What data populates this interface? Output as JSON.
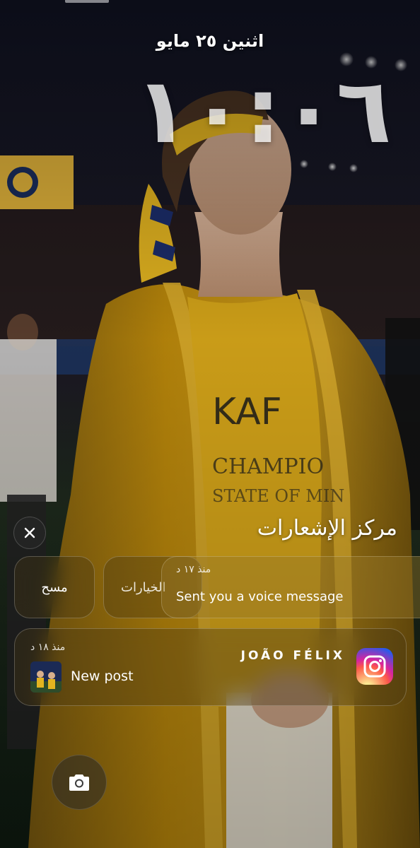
{
  "lockscreen": {
    "date": "اثنين ٢٥ مايو",
    "time": "١٠:٠٦"
  },
  "notification_center": {
    "title": "مركز الإشعارات",
    "clear_label": "مسح",
    "options_label": "الخيارات"
  },
  "notifications": [
    {
      "time": "منذ ١٧ د",
      "message": "Sent you a voice message"
    },
    {
      "sender": "JOÃO FÉLIX",
      "time": "منذ ١٨ د",
      "message": "New post",
      "app": "instagram-icon"
    }
  ],
  "colors": {
    "jersey_yellow": "#d4a419",
    "robe_gold": "#b8860b",
    "night_sky": "#121425"
  }
}
